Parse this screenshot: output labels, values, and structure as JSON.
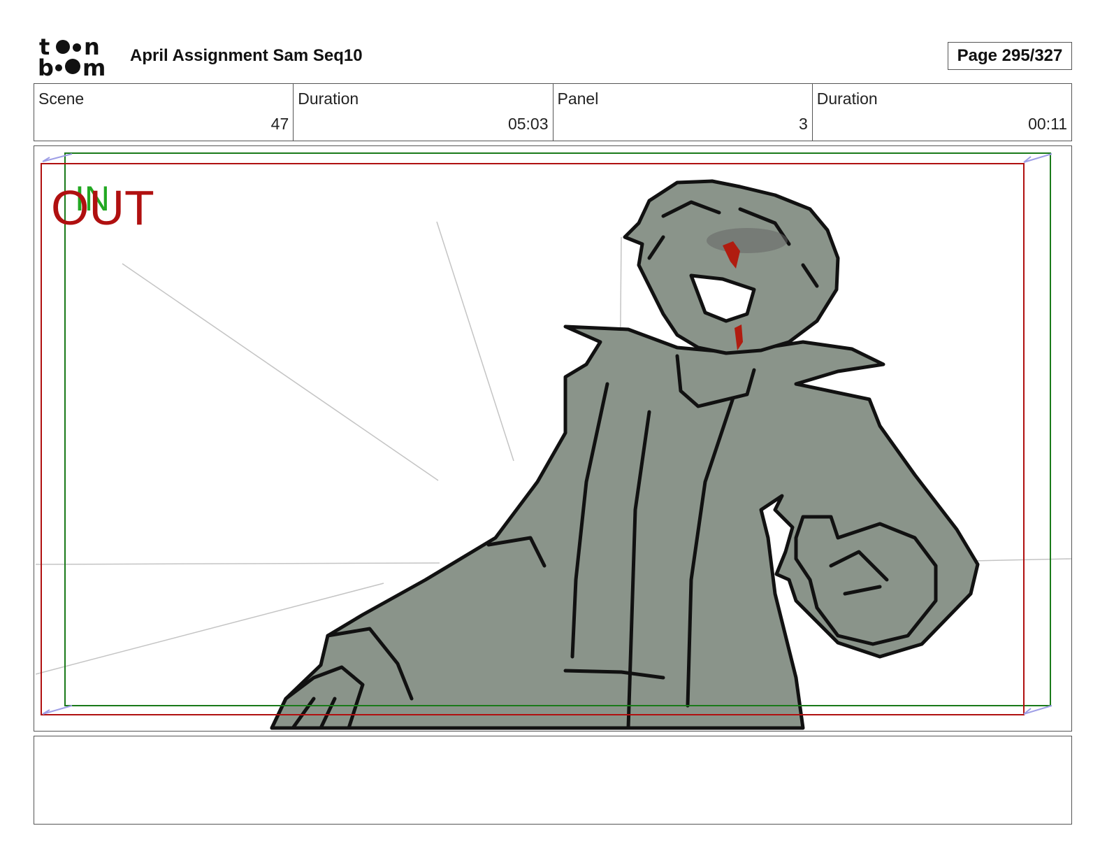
{
  "header": {
    "logo_alt": "toon boom",
    "project_title": "April Assignment Sam Seq10",
    "page_label": "Page 295/327"
  },
  "info": {
    "scene_label": "Scene",
    "scene_value": "47",
    "scene_duration_label": "Duration",
    "scene_duration_value": "05:03",
    "panel_label": "Panel",
    "panel_value": "3",
    "panel_duration_label": "Duration",
    "panel_duration_value": "00:11"
  },
  "panel": {
    "in_label": "IN",
    "out_label": "OUT",
    "in_frame_color": "#1a7a1a",
    "out_frame_color": "#b01010",
    "fill_color": "#8a948a"
  },
  "dialogue": {
    "text": ""
  }
}
